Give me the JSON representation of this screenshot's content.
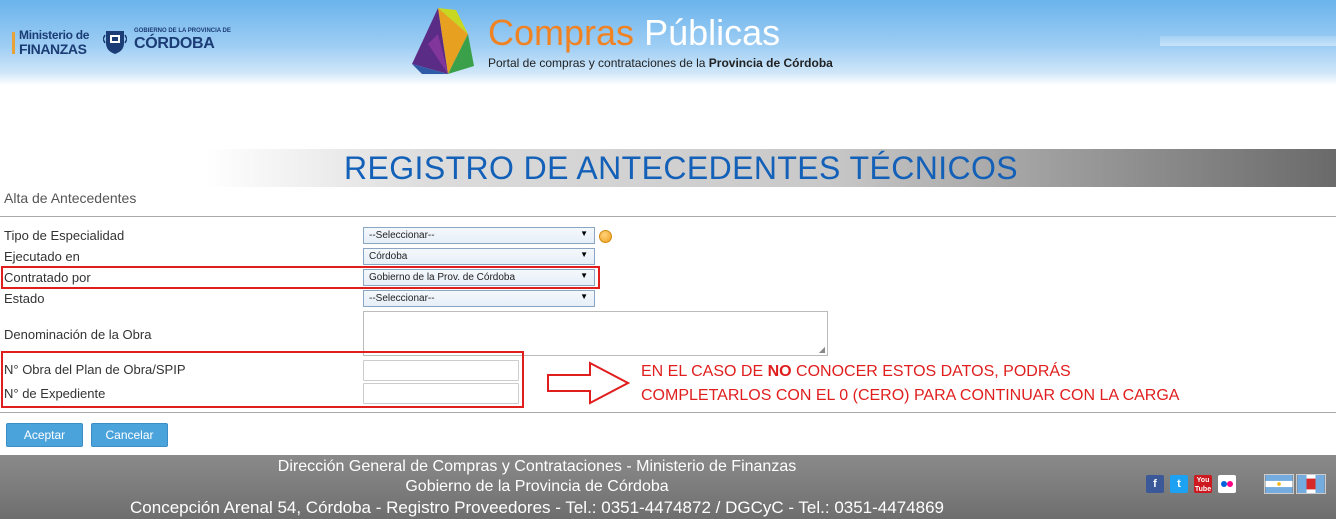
{
  "header": {
    "ministerio_line1": "Ministerio de",
    "ministerio_line2": "FINANZAS",
    "gobierno_small": "GOBIERNO DE LA PROVINCIA DE",
    "gobierno_big": "CÓRDOBA",
    "portal_word1": "Compras",
    "portal_word2": "Públicas",
    "portal_sub_prefix": "Portal de compras y contrataciones de la",
    "portal_sub_bold": "Provincia de Córdoba"
  },
  "banner": {
    "title": "REGISTRO DE ANTECEDENTES TÉCNICOS"
  },
  "form": {
    "section_title": "Alta de Antecedentes",
    "tipo_label": "Tipo de Especialidad",
    "tipo_value": "--Seleccionar--",
    "ejecutado_label": "Ejecutado en",
    "ejecutado_value": "Córdoba",
    "contratado_label": "Contratado por",
    "contratado_value": "Gobierno de la Prov. de Córdoba",
    "estado_label": "Estado",
    "estado_value": "--Seleccionar--",
    "denominacion_label": "Denominación de la Obra",
    "denominacion_value": "",
    "obra_label": "N° Obra del Plan de Obra/SPIP",
    "obra_value": "",
    "expediente_label": "N° de Expediente",
    "expediente_value": ""
  },
  "annotation": {
    "line1_prefix": "EN EL CASO DE ",
    "line1_bold": "NO",
    "line1_suffix": " CONOCER ESTOS DATOS, PODRÁS",
    "line2": "COMPLETARLOS CON EL 0 (CERO) PARA CONTINUAR CON LA CARGA",
    "color": "#e01e1e"
  },
  "buttons": {
    "accept": "Aceptar",
    "cancel": "Cancelar"
  },
  "footer": {
    "line1": "Dirección General de Compras y Contrataciones - Ministerio de Finanzas",
    "line2": "Gobierno de la Provincia de Córdoba",
    "line3": "Concepción Arenal 54, Córdoba - Registro Proveedores - Tel.: 0351-4474872 / DGCyC - Tel.: 0351-4474869",
    "social_icons": [
      "facebook-icon",
      "twitter-icon",
      "youtube-icon",
      "flickr-icon"
    ],
    "flags": [
      "argentina-flag",
      "cordoba-flag"
    ]
  },
  "colors": {
    "accent_blue": "#1360b8",
    "button": "#4ba3dc",
    "orange": "#f08222"
  }
}
